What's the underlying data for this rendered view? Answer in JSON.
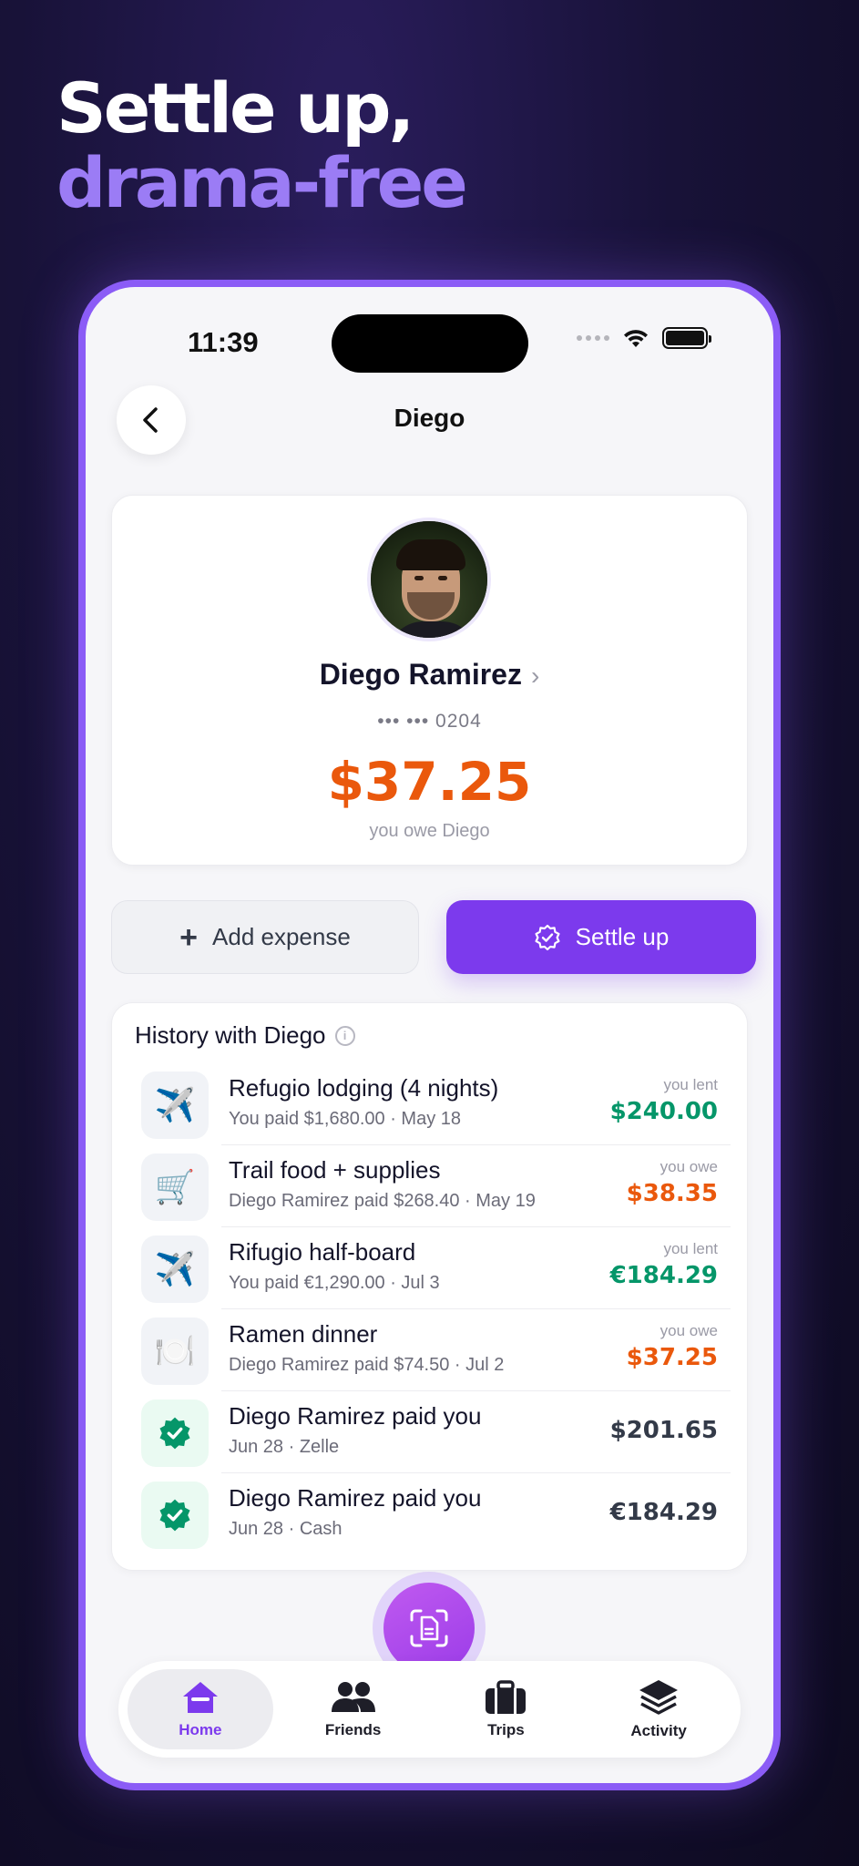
{
  "headline": {
    "line1": "Settle up,",
    "line2": "drama-free"
  },
  "status_bar": {
    "time": "11:39"
  },
  "nav": {
    "title": "Diego"
  },
  "profile": {
    "name": "Diego Ramirez",
    "phone": "••• ••• 0204",
    "amount": "$37.25",
    "caption": "you owe Diego",
    "amount_color": "#ea580c"
  },
  "actions": {
    "add_label": "Add expense",
    "settle_label": "Settle up"
  },
  "history": {
    "title": "History with Diego",
    "items": [
      {
        "icon": "airplane-icon",
        "glyph": "✈️",
        "title": "Refugio lodging (4 nights)",
        "sub": "You paid $1,680.00 · May 18",
        "label": "you lent",
        "amount": "$240.00"
      },
      {
        "icon": "cart-icon",
        "glyph": "🛒",
        "title": "Trail food + supplies",
        "sub": "Diego Ramirez paid $268.40 · May 19",
        "label": "you owe",
        "amount": "$38.35"
      },
      {
        "icon": "airplane-icon",
        "glyph": "✈️",
        "title": "Rifugio half-board",
        "sub": "You paid €1,290.00 · Jul 3",
        "label": "you lent",
        "amount": "€184.29"
      },
      {
        "icon": "plate-icon",
        "glyph": "🍽️",
        "title": "Ramen dinner",
        "sub": "Diego Ramirez paid $74.50 · Jul 2",
        "label": "you owe",
        "amount": "$37.25"
      },
      {
        "icon": "verified-check-icon",
        "glyph": "",
        "title": "Diego Ramirez paid you",
        "sub": "Jun 28 · Zelle",
        "label": "",
        "amount": "$201.65"
      },
      {
        "icon": "verified-check-icon",
        "glyph": "",
        "title": "Diego Ramirez paid you",
        "sub": "Jun 28 · Cash",
        "label": "",
        "amount": "€184.29"
      }
    ]
  },
  "tabs": [
    {
      "label": "Home",
      "icon": "home-icon",
      "active": true
    },
    {
      "label": "Friends",
      "icon": "friends-icon"
    },
    {
      "label": "Trips",
      "icon": "briefcase-icon"
    },
    {
      "label": "Activity",
      "icon": "layers-icon"
    }
  ],
  "colors": {
    "accent": "#7c3aed",
    "lent": "#059669",
    "owe": "#ea580c"
  }
}
